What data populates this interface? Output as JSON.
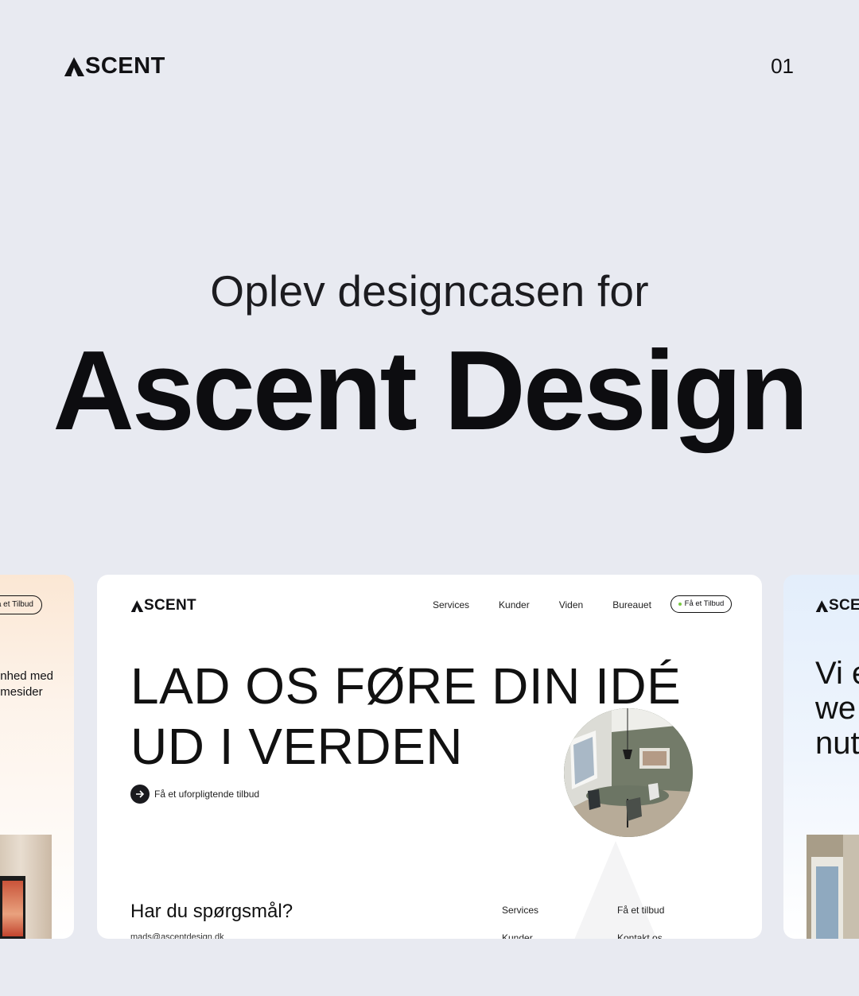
{
  "brand": {
    "logo_text": "SCENT",
    "logo_alt": "ASCENT"
  },
  "page_number": "01",
  "headline": {
    "subtitle": "Oplev designcasen for",
    "title": "Ascent Design"
  },
  "left_card": {
    "cta": "å et Tilbud",
    "text_lines": [
      "nhed med",
      "mesider"
    ]
  },
  "main_card": {
    "nav": [
      "Services",
      "Kunder",
      "Viden",
      "Bureauet"
    ],
    "cta": "Få et Tilbud",
    "hero_lines": [
      "LAD OS FØRE DIN IDÉ",
      "UD I VERDEN"
    ],
    "hero_cta": "Få et uforpligtende tilbud",
    "footer_question": "Har du spørgsmål?",
    "footer_email": "mads@ascentdesign.dk",
    "footer_col1": [
      "Services",
      "Kunder"
    ],
    "footer_col2": [
      "Få et tilbud",
      "Kontakt os"
    ]
  },
  "right_card": {
    "logo_text": "SCE",
    "hero_lines": [
      "Vi e",
      "we",
      "nut"
    ]
  }
}
